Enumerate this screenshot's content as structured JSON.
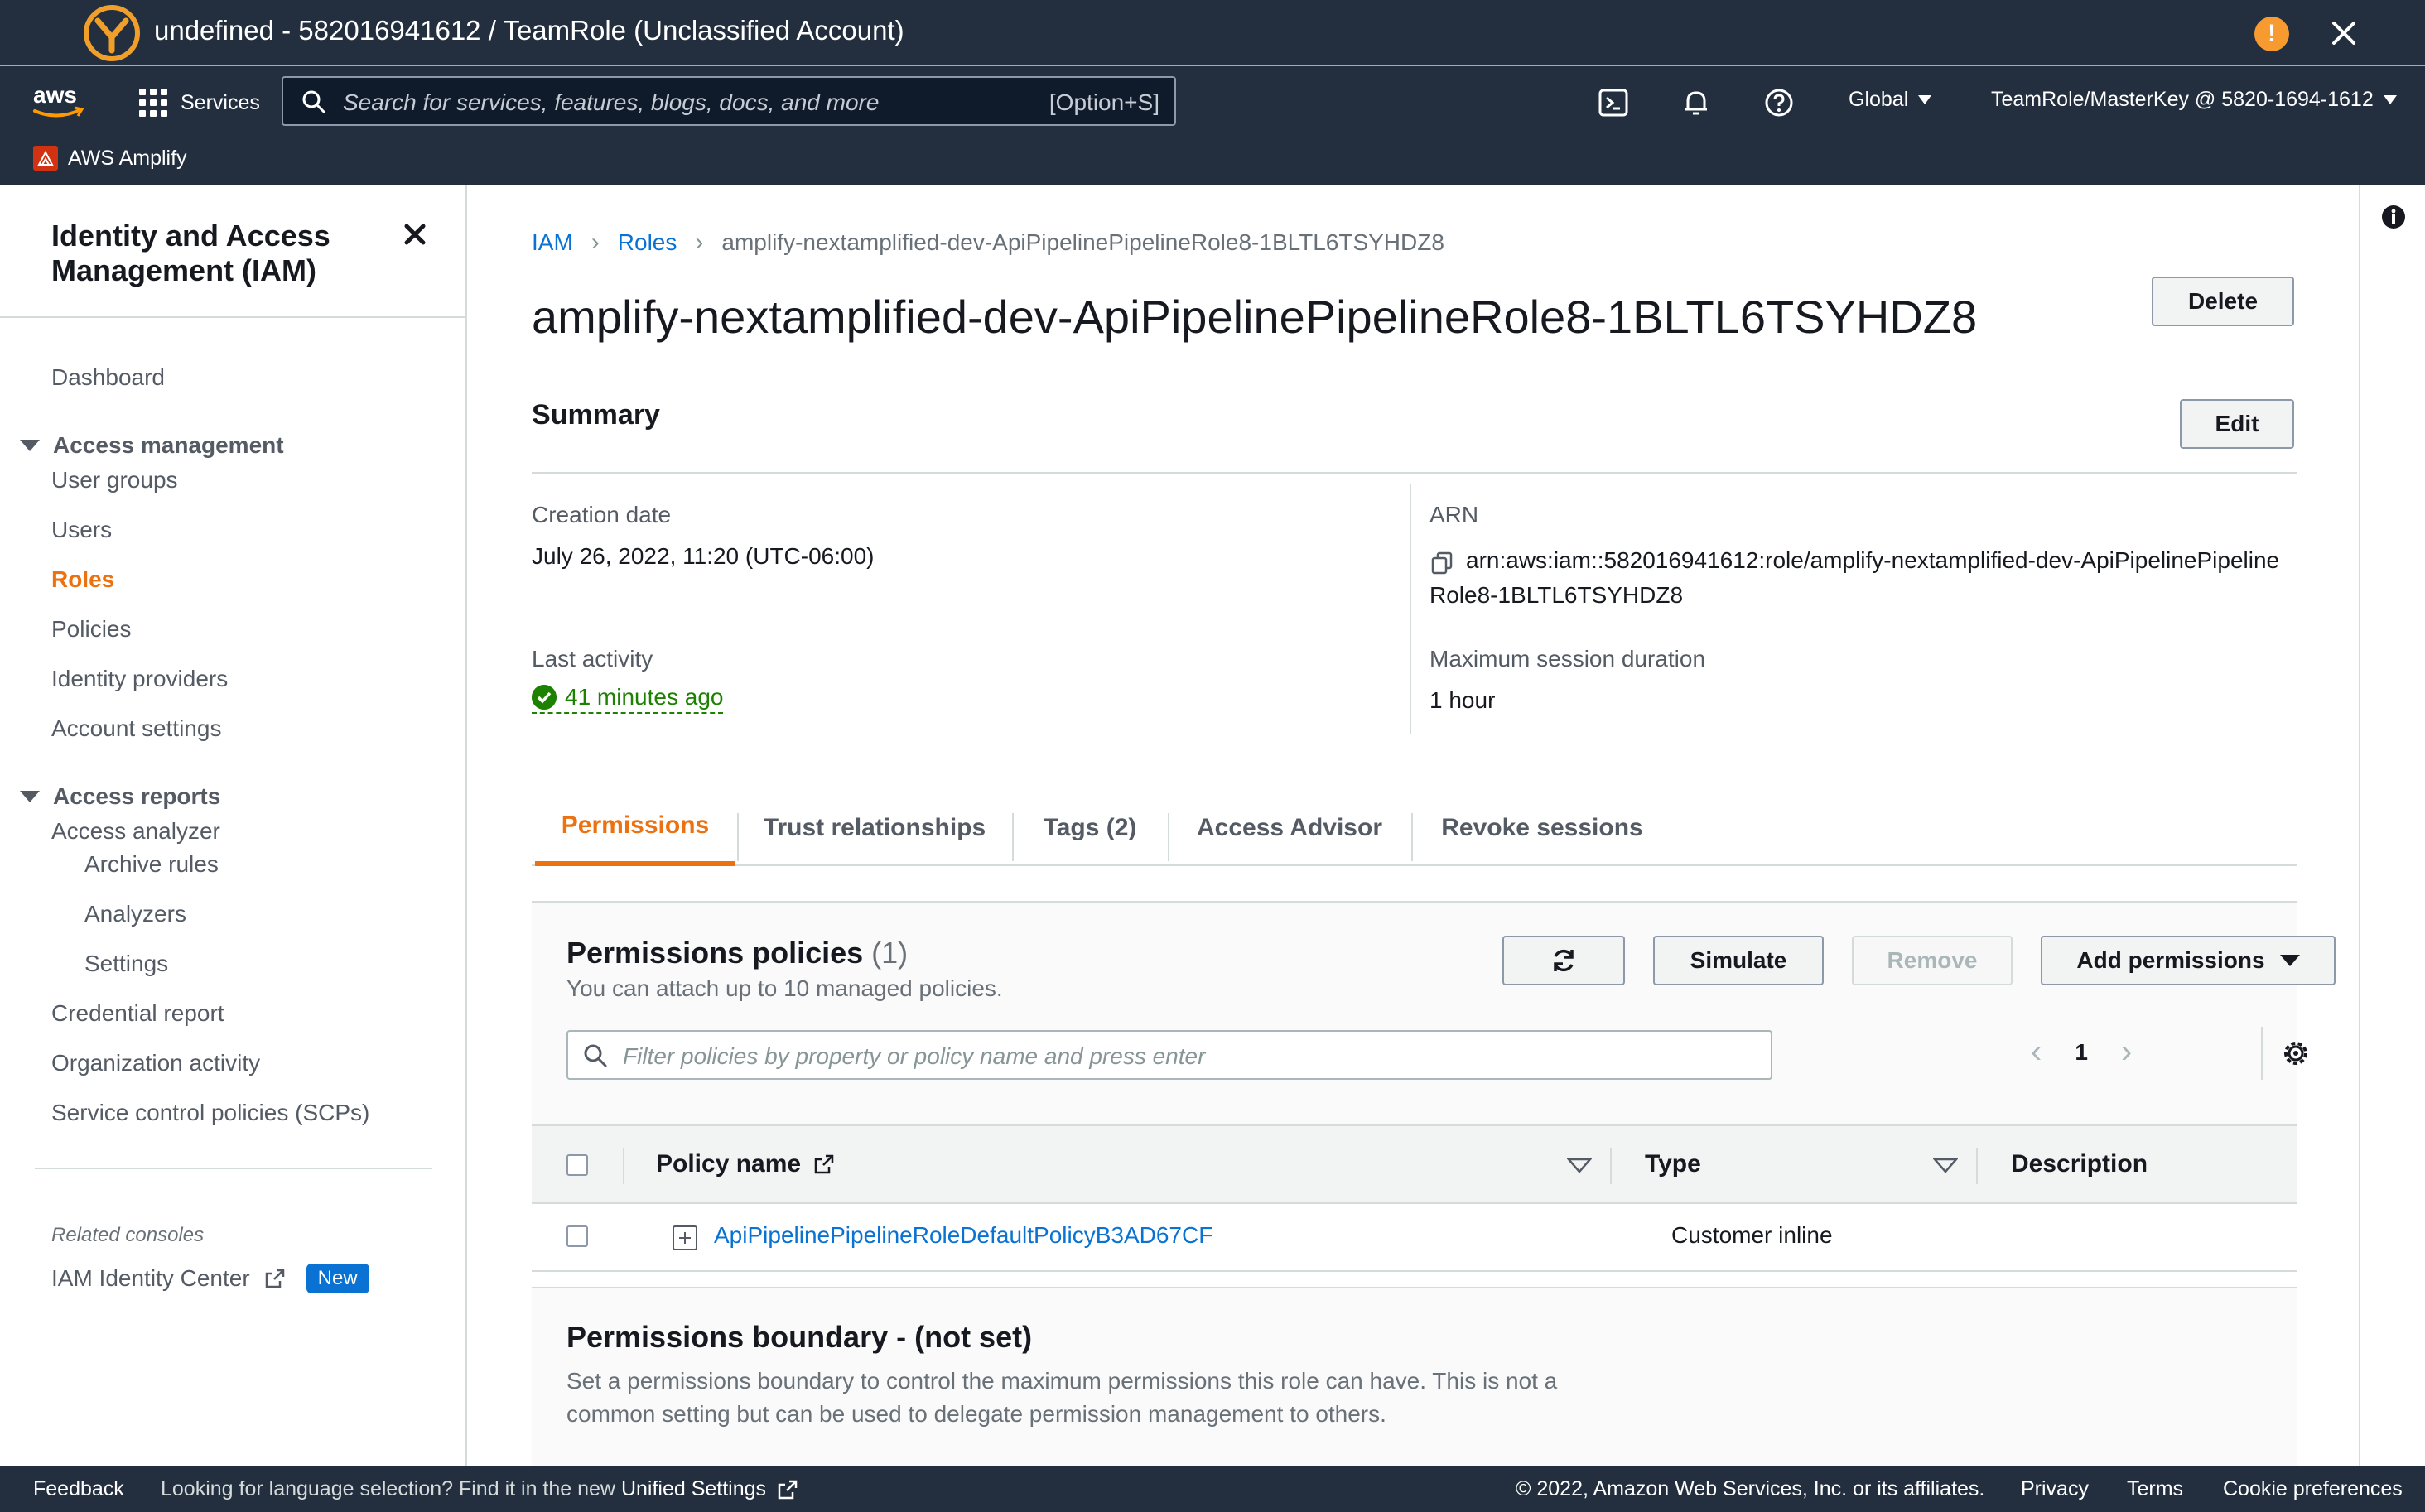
{
  "window": {
    "title": "undefined - 582016941612 / TeamRole (Unclassified Account)"
  },
  "topnav": {
    "aws_logo": "aws",
    "services_label": "Services",
    "search_placeholder": "Search for services, features, blogs, docs, and more",
    "search_shortcut": "[Option+S]",
    "region": "Global",
    "account": "TeamRole/MasterKey @ 5820-1694-1612",
    "favorite": "AWS Amplify",
    "icons": [
      "cloudshell-icon",
      "bell-icon",
      "help-icon"
    ]
  },
  "sidebar": {
    "title": "Identity and Access Management (IAM)",
    "dashboard": "Dashboard",
    "access_management": {
      "label": "Access management",
      "items": [
        "User groups",
        "Users",
        "Roles",
        "Policies",
        "Identity providers",
        "Account settings"
      ]
    },
    "access_reports": {
      "label": "Access reports",
      "items": [
        "Access analyzer",
        "Archive rules",
        "Analyzers",
        "Settings",
        "Credential report",
        "Organization activity",
        "Service control policies (SCPs)"
      ]
    },
    "related_consoles": "Related consoles",
    "identity_center": "IAM Identity Center",
    "new_badge": "New"
  },
  "breadcrumb": {
    "iam": "IAM",
    "roles": "Roles",
    "current": "amplify-nextamplified-dev-ApiPipelinePipelineRole8-1BLTL6TSYHDZ8"
  },
  "role": {
    "name": "amplify-nextamplified-dev-ApiPipelinePipelineRole8-1BLTL6TSYHDZ8",
    "delete_label": "Delete"
  },
  "summary": {
    "heading": "Summary",
    "edit_label": "Edit",
    "creation_date_label": "Creation date",
    "creation_date": "July 26, 2022, 11:20 (UTC-06:00)",
    "last_activity_label": "Last activity",
    "last_activity": "41 minutes ago",
    "arn_label": "ARN",
    "arn_line1": "arn:aws:iam::582016941612:role/amplify-nextamplified-dev-ApiPipelinePipeline",
    "arn_line2": "Role8-1BLTL6TSYHDZ8",
    "max_session_label": "Maximum session duration",
    "max_session": "1 hour"
  },
  "tabs": [
    "Permissions",
    "Trust relationships",
    "Tags (2)",
    "Access Advisor",
    "Revoke sessions"
  ],
  "permissions": {
    "title": "Permissions policies",
    "count": "(1)",
    "subtitle": "You can attach up to 10 managed policies.",
    "simulate": "Simulate",
    "remove": "Remove",
    "add": "Add permissions",
    "filter_placeholder": "Filter policies by property or policy name and press enter",
    "page": "1",
    "columns": [
      "Policy name",
      "Type",
      "Description"
    ],
    "rows": [
      {
        "name": "ApiPipelinePipelineRoleDefaultPolicyB3AD67CF",
        "type": "Customer inline",
        "description": ""
      }
    ]
  },
  "boundary": {
    "title": "Permissions boundary - (not set)",
    "description": "Set a permissions boundary to control the maximum permissions this role can have. This is not a common setting but can be used to delegate permission management to others."
  },
  "footer": {
    "feedback": "Feedback",
    "lang_prompt": "Looking for language selection? Find it in the new",
    "unified_settings": "Unified Settings",
    "copyright": "© 2022, Amazon Web Services, Inc. or its affiliates.",
    "privacy": "Privacy",
    "terms": "Terms",
    "cookies": "Cookie preferences"
  },
  "colors": {
    "nav_bg": "#232f3e",
    "accent_orange": "#ec7211",
    "link_blue": "#0972d3",
    "success_green": "#1d8102"
  }
}
